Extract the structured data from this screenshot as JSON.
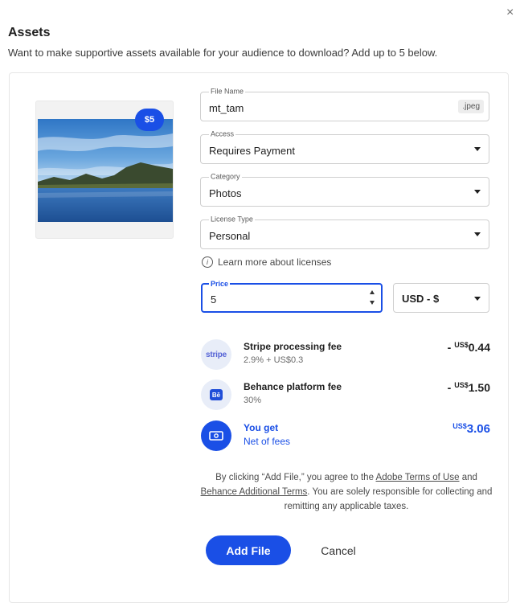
{
  "dialog": {
    "title": "Assets",
    "subtitle": "Want to make supportive assets available for your audience to download? Add up to 5 below.",
    "close_glyph": "×"
  },
  "asset": {
    "price_badge": "$5",
    "file_name_label": "File Name",
    "file_name_value": "mt_tam",
    "file_ext": "jpeg",
    "access_label": "Access",
    "access_value": "Requires Payment",
    "category_label": "Category",
    "category_value": "Photos",
    "license_label": "License Type",
    "license_value": "Personal",
    "learn_more": "Learn more about licenses",
    "price_label": "Price",
    "price_value": "5",
    "currency_value": "USD - $"
  },
  "fees": {
    "stripe": {
      "icon_text": "stripe",
      "name": "Stripe processing fee",
      "detail": "2.9% + US$0.3",
      "sign": "- ",
      "cur": "US$",
      "amount": "0.44"
    },
    "behance": {
      "icon_text": "Bē",
      "name": "Behance platform fee",
      "detail": "30%",
      "sign": "- ",
      "cur": "US$",
      "amount": "1.50"
    },
    "you_get": {
      "name": "You get",
      "detail": "Net of fees",
      "cur": "US$",
      "amount": "3.06"
    }
  },
  "terms": {
    "part1": "By clicking “Add File,” you agree to the ",
    "link1": "Adobe Terms of Use",
    "part2": " and ",
    "link2": "Behance Additional Terms",
    "part3": ". You are solely responsible for collecting and remitting any applicable taxes."
  },
  "actions": {
    "add_label": "Add File",
    "cancel_label": "Cancel"
  },
  "colors": {
    "accent": "#1a4fe6",
    "stripe_brand": "#5563d6"
  }
}
